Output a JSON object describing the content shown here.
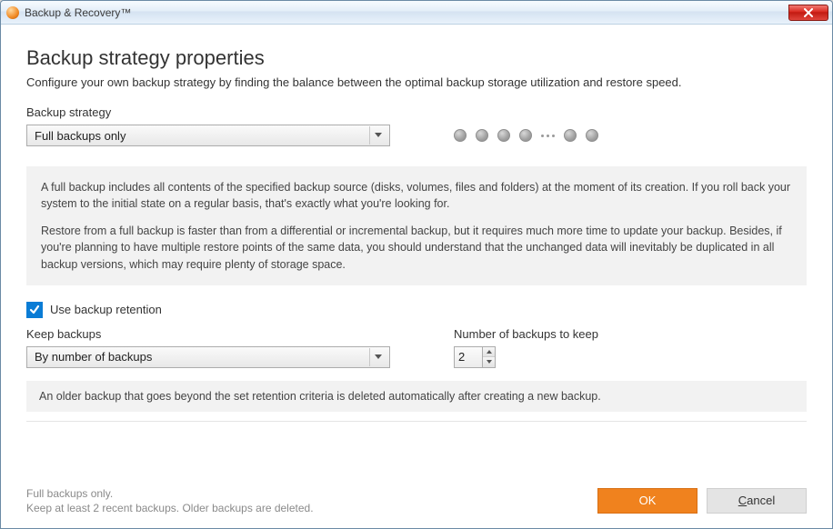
{
  "window": {
    "title": "Backup & Recovery™"
  },
  "header": {
    "title": "Backup strategy properties",
    "subtitle": "Configure your own backup strategy by finding the balance between the optimal backup storage utilization and restore speed."
  },
  "strategy": {
    "label": "Backup strategy",
    "selected": "Full backups only"
  },
  "info": {
    "p1": "A full backup includes all contents of the specified backup source (disks, volumes, files and folders) at the moment of its creation. If you roll back your system to the initial state on a regular basis, that's exactly what you're looking for.",
    "p2": "Restore from a full backup is faster than from a differential or incremental backup, but it requires much more time to update your backup. Besides, if you're planning to have multiple restore points of the same data, you should understand that the unchanged data will inevitably be duplicated in all backup versions, which may require plenty of storage space."
  },
  "retention": {
    "use_label": "Use backup retention",
    "checked": true,
    "keep_label": "Keep backups",
    "keep_selected": "By number of backups",
    "number_label": "Number of backups to keep",
    "number_value": "2",
    "note": "An older backup that goes beyond the set retention criteria is deleted automatically after creating a new backup."
  },
  "summary": {
    "line1": "Full backups only.",
    "line2": "Keep at least 2 recent backups. Older backups are deleted."
  },
  "buttons": {
    "ok": "OK",
    "cancel": "ancel"
  }
}
